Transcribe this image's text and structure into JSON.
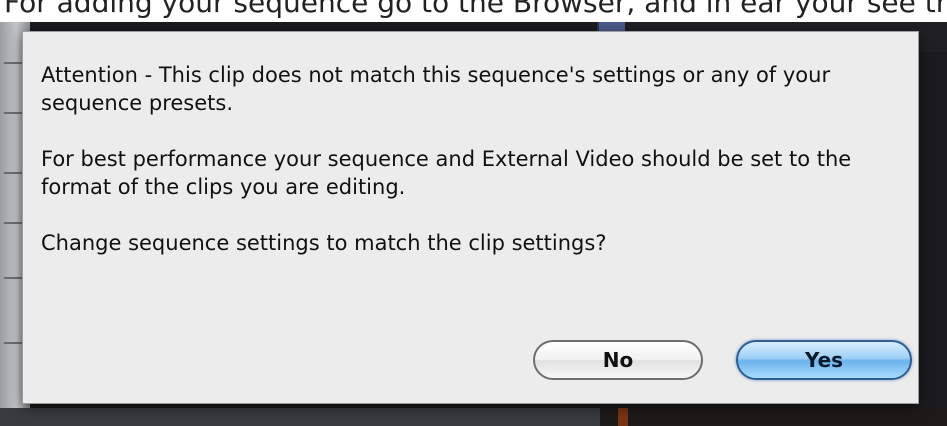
{
  "page_text": "For adding your sequence go to the Browser, and in ear your see that the",
  "dialog": {
    "paragraphs": [
      "Attention - This clip does not match this sequence's settings or any of your sequence presets.",
      "For best performance your sequence and External Video should be set to the format of the clips you are editing.",
      "Change sequence settings to match the clip settings?"
    ],
    "buttons": {
      "no_label": "No",
      "yes_label": "Yes"
    },
    "default_button_color": "#6cb2ec"
  },
  "colors": {
    "dialog_bg": "#ececec",
    "app_bg": "#1b1b1d"
  }
}
